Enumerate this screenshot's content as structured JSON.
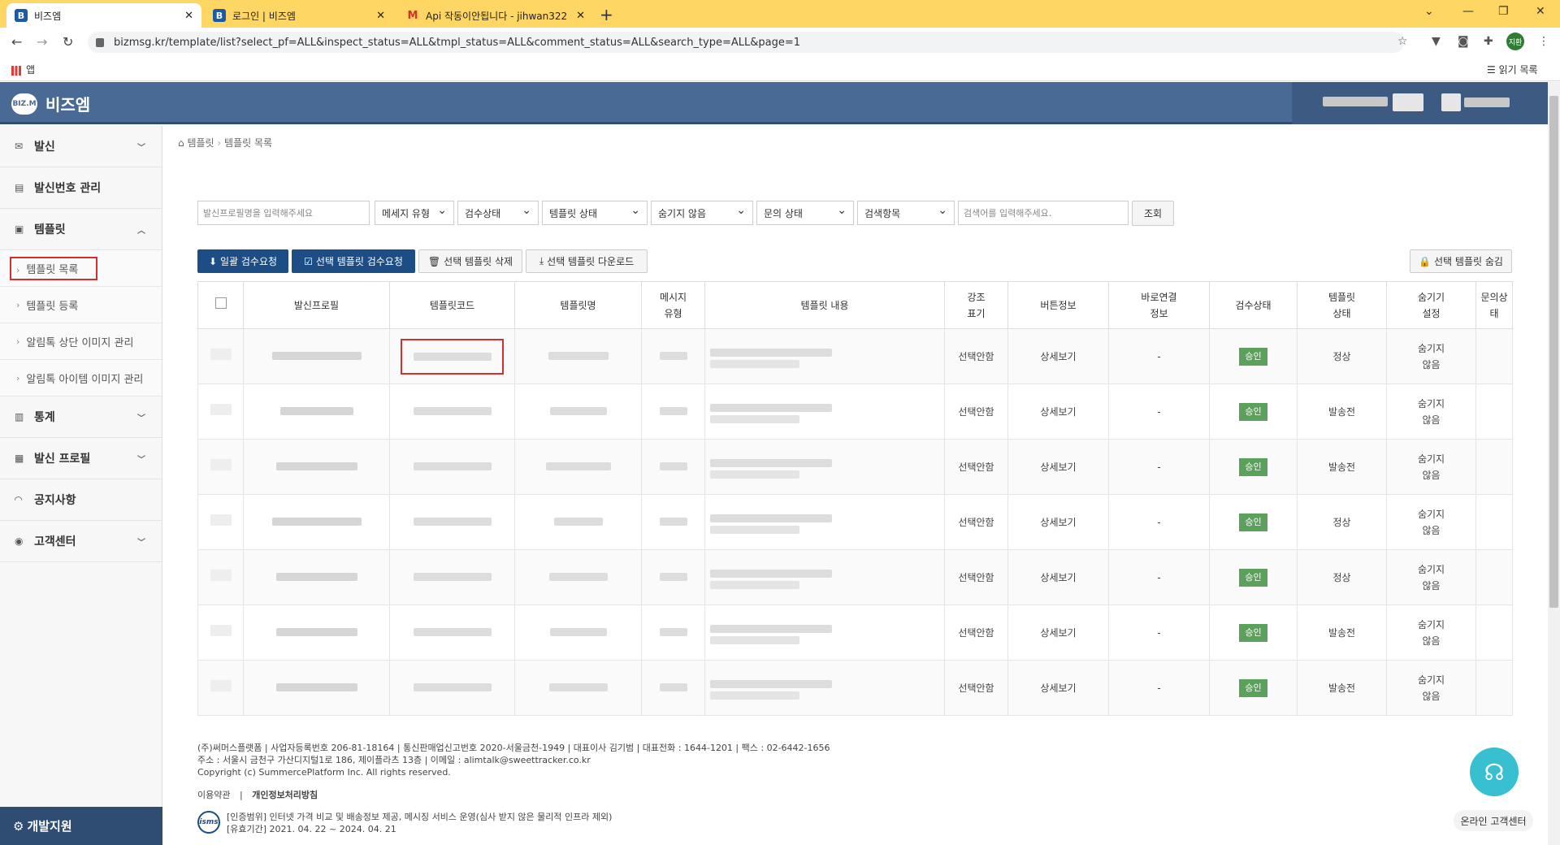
{
  "browser": {
    "tabs": [
      {
        "title": "비즈엠",
        "icon": "B"
      },
      {
        "title": "로그인 | 비즈엠",
        "icon": "B"
      },
      {
        "title": "Api 작동이안됩니다 - jihwan322",
        "icon": "M"
      }
    ],
    "url": "bizmsg.kr/template/list?select_pf=ALL&inspect_status=ALL&tmpl_status=ALL&comment_status=ALL&search_type=ALL&page=1",
    "bookmarks_apps": "앱",
    "reading_list": "읽기 목록",
    "profile_initial": "지환"
  },
  "site": {
    "logo_badge": "BIZ.M",
    "logo_text": "비즈엠"
  },
  "sidebar": {
    "items": [
      {
        "label": "발신"
      },
      {
        "label": "발신번호 관리"
      },
      {
        "label": "템플릿"
      },
      {
        "label": "통계"
      },
      {
        "label": "발신 프로필"
      },
      {
        "label": "공지사항"
      },
      {
        "label": "고객센터"
      }
    ],
    "sub": [
      {
        "label": "템플릿 목록"
      },
      {
        "label": "템플릿 등록"
      },
      {
        "label": "알림톡 상단 이미지 관리"
      },
      {
        "label": "알림톡 아이템 이미지 관리"
      }
    ],
    "dev_button": "개발지원"
  },
  "breadcrumb": {
    "root": "템플릿",
    "current": "템플릿 목록"
  },
  "filters": {
    "profile_placeholder": "발신프로필명을 입력해주세요",
    "message_type": "메세지 유형",
    "inspect_status": "검수상태",
    "template_status": "템플릿 상태",
    "hidden": "숨기지 않음",
    "comment_status": "문의 상태",
    "search_field": "검색항목",
    "keyword_placeholder": "검색어를 입력해주세요.",
    "search_button": "조회"
  },
  "actions": {
    "bulk_inspect": "일괄 검수요청",
    "selected_inspect": "선택 템플릿 검수요청",
    "selected_delete": "선택 템플릿 삭제",
    "selected_download": "선택 템플릿 다운로드",
    "selected_hide": "선택 템플릿 숨김"
  },
  "table": {
    "headers": [
      "발신프로필",
      "템플릿코드",
      "템플릿명",
      "메시지\n유형",
      "템플릿 내용",
      "강조\n표기",
      "버튼정보",
      "바로연결\n정보",
      "검수상태",
      "템플릿\n상태",
      "숨기기\n설정",
      "문의상태"
    ],
    "rows": [
      {
        "emphasis": "선택안함",
        "button": "상세보기",
        "quick": "-",
        "inspect": "승인",
        "status": "정상",
        "hide": "숨기지\n않음"
      },
      {
        "emphasis": "선택안함",
        "button": "상세보기",
        "quick": "-",
        "inspect": "승인",
        "status": "발송전",
        "hide": "숨기지\n않음"
      },
      {
        "emphasis": "선택안함",
        "button": "상세보기",
        "quick": "-",
        "inspect": "승인",
        "status": "발송전",
        "hide": "숨기지\n않음"
      },
      {
        "emphasis": "선택안함",
        "button": "상세보기",
        "quick": "-",
        "inspect": "승인",
        "status": "정상",
        "hide": "숨기지\n않음"
      },
      {
        "emphasis": "선택안함",
        "button": "상세보기",
        "quick": "-",
        "inspect": "승인",
        "status": "정상",
        "hide": "숨기지\n않음"
      },
      {
        "emphasis": "선택안함",
        "button": "상세보기",
        "quick": "-",
        "inspect": "승인",
        "status": "발송전",
        "hide": "숨기지\n않음"
      },
      {
        "emphasis": "선택안함",
        "button": "상세보기",
        "quick": "-",
        "inspect": "승인",
        "status": "발송전",
        "hide": "숨기지\n않음"
      }
    ]
  },
  "footer": {
    "line1": "(주)써머스플랫폼  |  사업자등록번호 206-81-18164  |  통신판매업신고번호 2020-서울금천-1949  |  대표이사 김기범  |  대표전화 : 1644-1201  |  팩스 : 02-6442-1656",
    "line2": "주소 : 서울시 금천구 가산디지털1로 186, 제이플라츠 13층  |  이메일 : alimtalk@sweettracker.co.kr",
    "line3": "Copyright (c) SummercePlatform Inc. All rights reserved.",
    "terms": "이용약관",
    "privacy": "개인정보처리방침",
    "isms_badge": "isms",
    "isms1": "[인증범위] 인터넷 가격 비교 및 배송정보 제공, 메시징 서비스 운영(심사 받지 않은 물리적 인프라 제외)",
    "isms2": "[유효기간] 2021. 04. 22 ~ 2024. 04. 21"
  },
  "chat_label": "온라인 고객센터"
}
